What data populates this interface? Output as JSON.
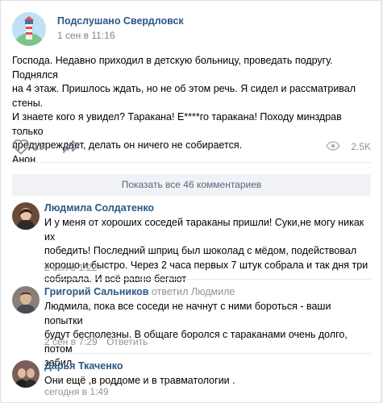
{
  "post": {
    "group_name": "Подслушано Свердловск",
    "date": "1 сен в 11:16",
    "text_lines": [
      "Господа. Недавно приходил в детскую больницу, проведать подругу. Поднялся",
      "на 4 этаж. Пришлось ждать, но не об этом речь. Я сидел и рассматривал стены.",
      "И знаете кого я увидел? Таракана! Е****го таракана! Походу минздрав только",
      "предупреждает, делать он ничего не собирается.",
      "Анон"
    ],
    "likes": "19",
    "views": "2.5K"
  },
  "show_all_comments": "Показать все 46 комментариев",
  "comments": [
    {
      "author": "Людмила Солдатенко",
      "text_lines": [
        "И у меня от хороших соседей тараканы пришли! Суки,не могу никак их",
        "победить! Последний шприц был шоколад с мёдом, подействовал",
        "хорошо и быстро. Через 2 часа первых 7 штук собрала и так дня три",
        "собирала. И всё равно бегают"
      ],
      "date": "2 сен в 1:22"
    },
    {
      "author": "Григорий Сальников",
      "reply_word": "ответил",
      "reply_to": "Людмиле",
      "text_lines": [
        "Людмила, пока все соседи не начнут с ними бороться - ваши попытки",
        "будут бесполезны. В общаге боролся с тараканами очень долго, потом",
        "забил"
      ],
      "date": "2 сен в 7:29",
      "reply_label": "Ответить"
    },
    {
      "author": "Дарья Ткаченко",
      "text_lines": [
        "Они ещё ,в роддоме и в травматологии ."
      ],
      "date": "сегодня в 1:49"
    }
  ],
  "colors": {
    "link": "#2a5885",
    "meta": "#939393",
    "show_all_bg": "#f0f2f5"
  }
}
